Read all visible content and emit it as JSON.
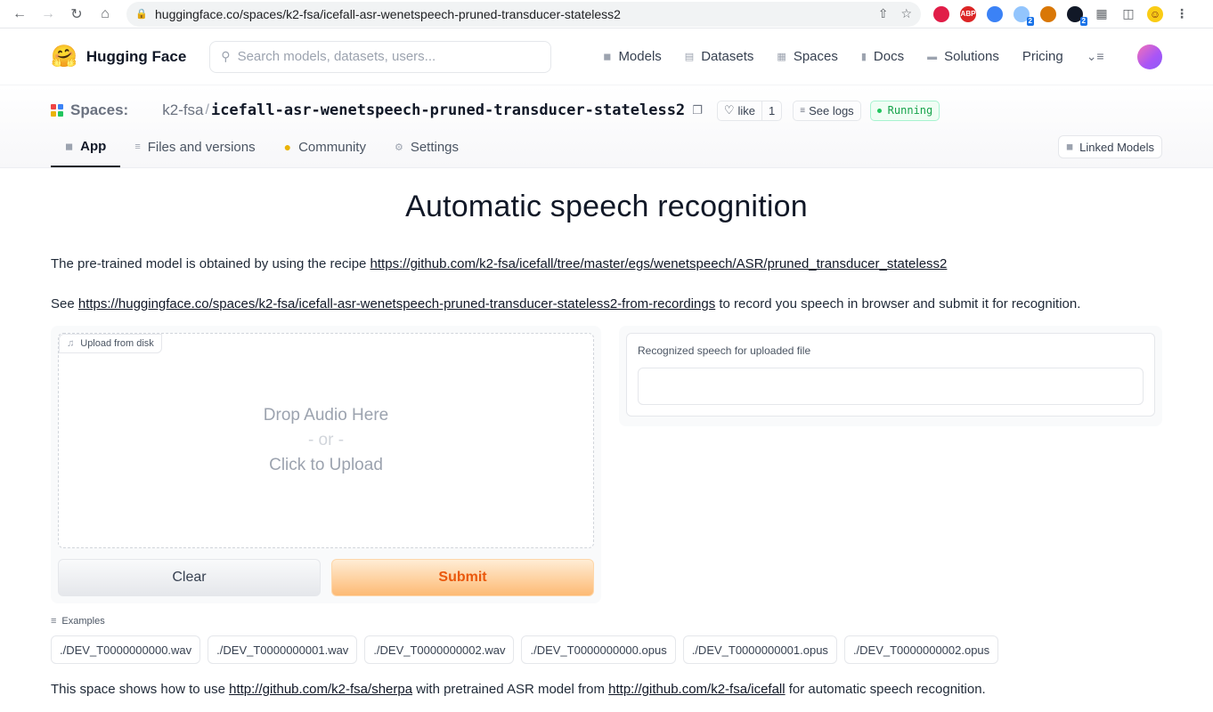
{
  "browser": {
    "url_host": "huggingface.co",
    "url_path": "/spaces/k2-fsa/icefall-asr-wenetspeech-pruned-transducer-stateless2",
    "extensions": [
      {
        "name": "opera-icon",
        "color": "#e11d48",
        "label": ""
      },
      {
        "name": "adblock-icon",
        "color": "#dc2626",
        "label": "ABP"
      },
      {
        "name": "arrow-extension-icon",
        "color": "#3b82f6",
        "label": ""
      },
      {
        "name": "globe-extension-icon",
        "color": "#93c5fd",
        "label": "",
        "badge": "2"
      },
      {
        "name": "cookie-icon",
        "color": "#d97706",
        "label": ""
      },
      {
        "name": "github-extension-icon",
        "color": "#111827",
        "label": "",
        "badge": "2"
      }
    ]
  },
  "header": {
    "brand": "Hugging Face",
    "search_placeholder": "Search models, datasets, users...",
    "nav": [
      "Models",
      "Datasets",
      "Spaces",
      "Docs",
      "Solutions",
      "Pricing"
    ]
  },
  "space": {
    "label": "Spaces:",
    "owner": "k2-fsa",
    "repo": "icefall-asr-wenetspeech-pruned-transducer-stateless2",
    "like_label": "like",
    "like_count": "1",
    "logs_label": "See logs",
    "status": "Running",
    "tabs": [
      "App",
      "Files and versions",
      "Community",
      "Settings"
    ],
    "linked": "Linked Models"
  },
  "main": {
    "title": "Automatic speech recognition",
    "intro_prefix": "The pre-trained model is obtained by using the recipe ",
    "intro_link": "https://github.com/k2-fsa/icefall/tree/master/egs/wenetspeech/ASR/pruned_transducer_stateless2",
    "see_prefix": "See ",
    "see_link": "https://huggingface.co/spaces/k2-fsa/icefall-asr-wenetspeech-pruned-transducer-stateless2-from-recordings",
    "see_suffix": " to record you speech in browser and submit it for recognition.",
    "upload_tag": "Upload from disk",
    "drop_line1": "Drop Audio Here",
    "drop_line2": "- or -",
    "drop_line3": "Click to Upload",
    "clear": "Clear",
    "submit": "Submit",
    "output_label": "Recognized speech for uploaded file",
    "output_value": "",
    "examples_label": "Examples",
    "examples": [
      "./DEV_T0000000000.wav",
      "./DEV_T0000000001.wav",
      "./DEV_T0000000002.wav",
      "./DEV_T0000000000.opus",
      "./DEV_T0000000001.opus",
      "./DEV_T0000000002.opus"
    ],
    "foot_prefix": "This space shows how to use ",
    "foot_link1": "http://github.com/k2-fsa/sherpa",
    "foot_mid": " with pretrained ASR model from ",
    "foot_link2": "http://github.com/k2-fsa/icefall",
    "foot_suffix": " for automatic speech recognition."
  }
}
